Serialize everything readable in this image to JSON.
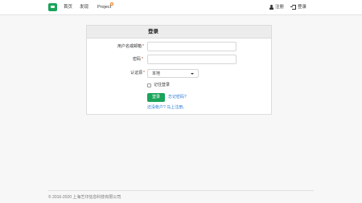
{
  "nav": {
    "home": "首页",
    "discover": "发现",
    "project": "Project",
    "register": "注册",
    "login": "登录"
  },
  "colors": {
    "brand": "#1aa35a",
    "link": "#2a7bd6",
    "badge": "#e67e22"
  },
  "form": {
    "title": "登录",
    "username_label": "用户名或邮箱",
    "password_label": "密码",
    "source_label": "认证源",
    "required_mark": "*",
    "source_value": "本地",
    "remember_label": "记住登录",
    "submit_label": "登录",
    "forgot_link": "忘记密码?",
    "register_prompt": "还没帐户? 马上注册。"
  },
  "footer": {
    "text": "© 2016-2020 上海艺印信息科技有限公司"
  }
}
